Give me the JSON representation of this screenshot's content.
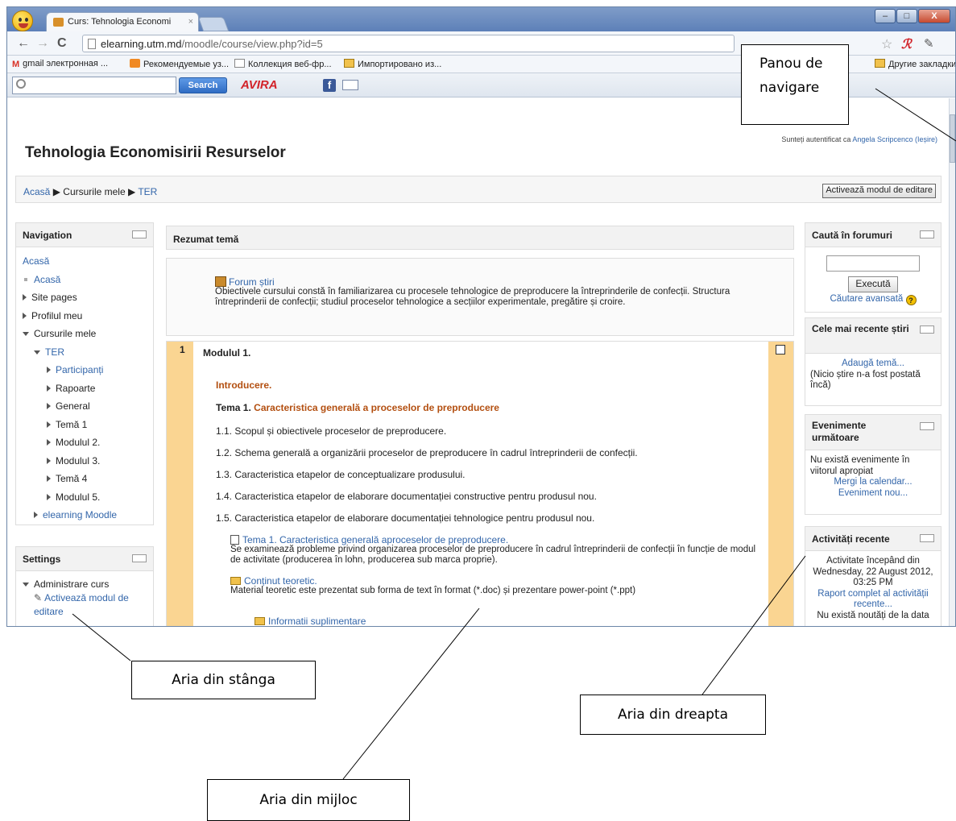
{
  "browser": {
    "tab_title": "Curs: Tehnologia Economi",
    "tab_close": "×",
    "url_host": "elearning.utm.md",
    "url_path": "/moodle/course/view.php?id=5",
    "nav_back": "←",
    "nav_forward": "→",
    "nav_reload": "C",
    "bookmarks": [
      {
        "label": "gmail электронная ...",
        "icon": "gmail-icon"
      },
      {
        "label": "Рекомендуемые уз...",
        "icon": "recommended-icon"
      },
      {
        "label": "Коллекция веб-фр...",
        "icon": "page-icon"
      },
      {
        "label": "Импортировано из...",
        "icon": "folder-icon"
      }
    ],
    "bookmarks_other": "Другие закладки",
    "search_button": "Search",
    "avira_logo": "AVIRA",
    "facebook": "f",
    "win_min": "–",
    "win_max": "□",
    "win_close": "X"
  },
  "page": {
    "login_prefix": "Sunteți autentificat ca",
    "login_user": "Angela Scripcenco",
    "login_logout": "(Ieșire)",
    "title": "Tehnologia Economisirii Resurselor",
    "breadcrumb": {
      "home": "Acasă",
      "sep": "▶",
      "mycourses": "Cursurile mele",
      "course": "TER"
    },
    "edit_button": "Activează modul de editare"
  },
  "navigation": {
    "title": "Navigation",
    "home_top": "Acasă",
    "home": "Acasă",
    "site_pages": "Site pages",
    "profile": "Profilul meu",
    "my_courses": "Cursurile mele",
    "course": "TER",
    "items": [
      "Participanți",
      "Rapoarte",
      "General",
      "Temă 1",
      "Modulul 2.",
      "Modulul 3.",
      "Temă 4",
      "Modulul 5."
    ],
    "elearning": "elearning Moodle"
  },
  "settings": {
    "title": "Settings",
    "admin": "Administrare curs",
    "edit_mode": "Activează modul de editare"
  },
  "main": {
    "summary_title": "Rezumat temă",
    "forum_link": "Forum știri",
    "forum_desc": "Obiectivele cursului constă în familiarizarea cu procesele tehnologice de preproducere la întreprinderile de confecții. Structura întreprinderii de confecții; studiul proceselor tehnologice a secțiilor experimentale, pregătire și croire.",
    "module_number": "1",
    "module_title": "Modulul 1.",
    "intro": "Introducere.",
    "topic_prefix": "Tema 1.",
    "topic_title": "Caracteristica generală a proceselor de preproducere",
    "points": [
      "1.1. Scopul și obiectivele proceselor de preproducere.",
      "1.2. Schema generală a organizării proceselor de preproducere în cadrul întreprinderii de confecții.",
      "1.3. Caracteristica etapelor de conceptualizare produsului.",
      "1.4. Caracteristica etapelor de elaborare documentației constructive pentru produsul nou.",
      "1.5. Caracteristica etapelor de elaborare documentației tehnologice pentru produsul nou."
    ],
    "resource_link": "Tema 1. Caracteristica generală aproceselor de preproducere.",
    "resource_desc": "Se examinează probleme privind organizarea proceselor de preproducere în cadrul întreprinderii de confecții în funcție de modul de activitate (producerea în lohn, producerea sub marca proprie).",
    "folder_link": "Conținut teoretic.",
    "folder_desc": "Material teoretic este prezentat sub forma de text în format (*.doc) și prezentare power-point (*.ppt)",
    "extra_link": "Informatii suplimentare"
  },
  "right": {
    "search_title": "Caută în forumuri",
    "search_button": "Execută",
    "advanced": "Căutare avansată",
    "help": "?",
    "news_title": "Cele mai recente știri",
    "news_add": "Adaugă temă...",
    "news_empty": "(Nicio știre n-a fost postată încă)",
    "events_title": "Evenimente următoare",
    "events_empty": "Nu există evenimente în viitorul apropiat",
    "events_calendar": "Mergi la calendar...",
    "events_new": "Eveniment nou...",
    "activity_title": "Activități recente",
    "activity_since": "Activitate începând din Wednesday, 22 August 2012, 03:25 PM",
    "activity_report": "Raport complet al activității recente...",
    "activity_none": "Nu există noutăți de la data"
  },
  "callouts": {
    "panou": "Panou de navigare",
    "stanga": "Aria din stânga",
    "dreapta": "Aria din dreapta",
    "mijloc": "Aria din mijloc"
  }
}
